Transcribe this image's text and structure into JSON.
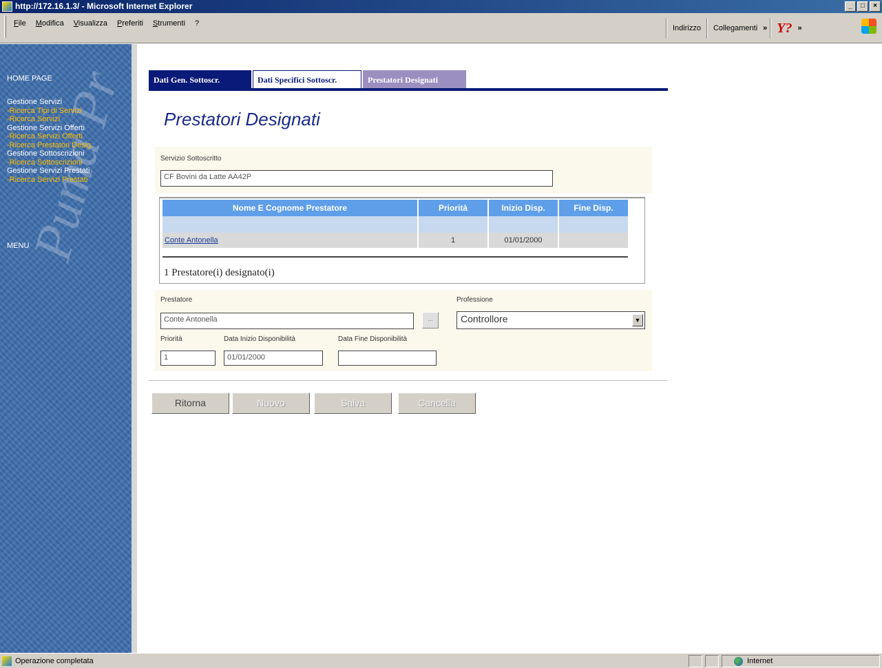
{
  "window": {
    "title": "http://172.16.1.3/ - Microsoft Internet Explorer",
    "min_glyph": "_",
    "max_glyph": "□",
    "close_glyph": "×"
  },
  "menubar": {
    "items": [
      "File",
      "Modifica",
      "Visualizza",
      "Preferiti",
      "Strumenti",
      "?"
    ],
    "address_label": "Indirizzo",
    "links_label": "Collegamenti",
    "chevron": "»",
    "yahoo": "Y?",
    "chevron2": "»"
  },
  "sidebar": {
    "home": "HOME PAGE",
    "items": [
      {
        "label": "Gestione Servizi",
        "kind": "section"
      },
      {
        "label": "-Ricerca Tipi di Servizi",
        "kind": "link"
      },
      {
        "label": "-Ricerca Servizi",
        "kind": "link"
      },
      {
        "label": "Gestione Servizi Offerti",
        "kind": "section"
      },
      {
        "label": "-Ricerca Servizi Offerti",
        "kind": "link"
      },
      {
        "label": "-Ricerca Prestatori Desig.",
        "kind": "link"
      },
      {
        "label": "Gestione Sottoscrizioni",
        "kind": "section"
      },
      {
        "label": "-Ricerca Sottoscrizioni",
        "kind": "link"
      },
      {
        "label": "Gestione Servizi Prestati",
        "kind": "section"
      },
      {
        "label": "-Ricerca Servizi Prestati",
        "kind": "link"
      }
    ],
    "menu": "MENU",
    "watermark": "Puma Pr"
  },
  "tabs": [
    {
      "label": "Dati Gen. Sottoscr."
    },
    {
      "label": "Dati Specifici Sottoscr."
    },
    {
      "label": "Prestatori Designati"
    }
  ],
  "page_title": "Prestatori Designati",
  "servizio": {
    "label": "Servizio Sottoscritto",
    "value": "CF Bovini da Latte AA42P"
  },
  "table": {
    "headers": [
      "Nome E Cognome Prestatore",
      "Priorità",
      "Inizio Disp.",
      "Fine Disp."
    ],
    "rows": [
      {
        "nome": "Conte Antonella",
        "priorita": "1",
        "inizio": "01/01/2000",
        "fine": ""
      }
    ],
    "count_text": "1 Prestatore(i) designato(i)"
  },
  "form": {
    "prestatore_label": "Prestatore",
    "prestatore_value": "Conte Antonella",
    "lookup_label": "...",
    "professione_label": "Professione",
    "professione_value": "Controllore",
    "priorita_label": "Priorità",
    "priorita_value": "1",
    "inizio_label": "Data Inizio Disponibilità",
    "inizio_value": "01/01/2000",
    "fine_label": "Data Fine Disponibilità",
    "fine_value": ""
  },
  "buttons": {
    "ritorna": "Ritorna",
    "nuovo": "Nuovo",
    "salva": "Salva",
    "cancella": "Cancella"
  },
  "status": {
    "text": "Operazione completata",
    "zone": "Internet"
  }
}
